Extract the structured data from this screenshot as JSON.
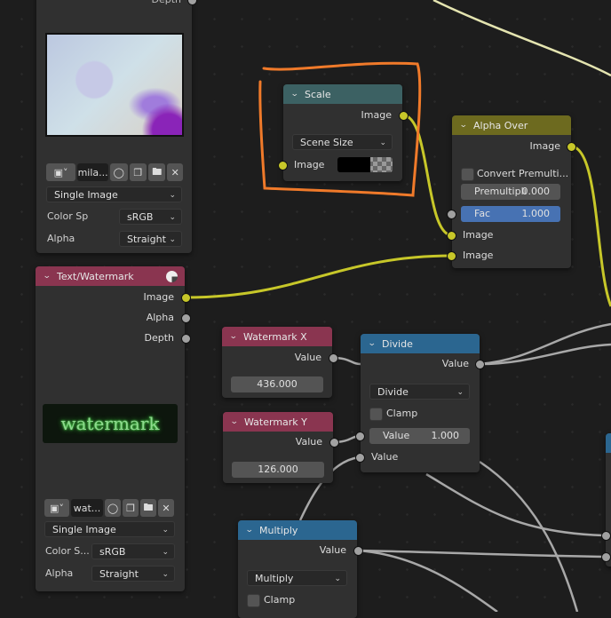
{
  "app": "Blender Compositor",
  "annotation": {
    "color": "#f07a2a",
    "target": "Scale node"
  },
  "nodes": {
    "top_image": {
      "partial_output": "Depth",
      "image_name": "mila...",
      "source": "Single Image",
      "color_space_label": "Color Sp",
      "color_space": "sRGB",
      "alpha_label": "Alpha",
      "alpha": "Straight",
      "header_color": "#8a3550"
    },
    "scale": {
      "title": "Scale",
      "output": "Image",
      "mode": "Scene Size",
      "input": "Image",
      "header_color": "#3c6163"
    },
    "alpha_over": {
      "title": "Alpha Over",
      "output": "Image",
      "convert_label": "Convert Premulti...",
      "convert_checked": false,
      "premul_label": "Premultipli",
      "premul_value": "0.000",
      "fac_label": "Fac",
      "fac_value": "1.000",
      "input1": "Image",
      "input2": "Image",
      "header_color": "#6d6a1f"
    },
    "text_watermark": {
      "title": "Text/Watermark",
      "outputs": [
        "Image",
        "Alpha",
        "Depth"
      ],
      "preview_text": "watermark",
      "image_name": "wat...",
      "source": "Single Image",
      "color_space_label": "Color S...",
      "color_space": "sRGB",
      "alpha_label": "Alpha",
      "alpha": "Straight",
      "header_color": "#8a3550"
    },
    "watermark_x": {
      "title": "Watermark X",
      "output": "Value",
      "value": "436.000"
    },
    "watermark_y": {
      "title": "Watermark Y",
      "output": "Value",
      "value": "126.000"
    },
    "divide": {
      "title": "Divide",
      "output": "Value",
      "operation": "Divide",
      "clamp_label": "Clamp",
      "clamp_checked": false,
      "input1_label": "Value",
      "input1_value": "1.000",
      "input2_label": "Value",
      "header_color": "#2b6690"
    },
    "multiply": {
      "title": "Multiply",
      "output": "Value",
      "operation": "Multiply",
      "clamp_label": "Clamp",
      "clamp_checked": false,
      "header_color": "#2b6690"
    }
  },
  "colors": {
    "image_socket": "#c7c729",
    "value_socket": "#a1a1a1",
    "background": "#1d1d1d"
  }
}
